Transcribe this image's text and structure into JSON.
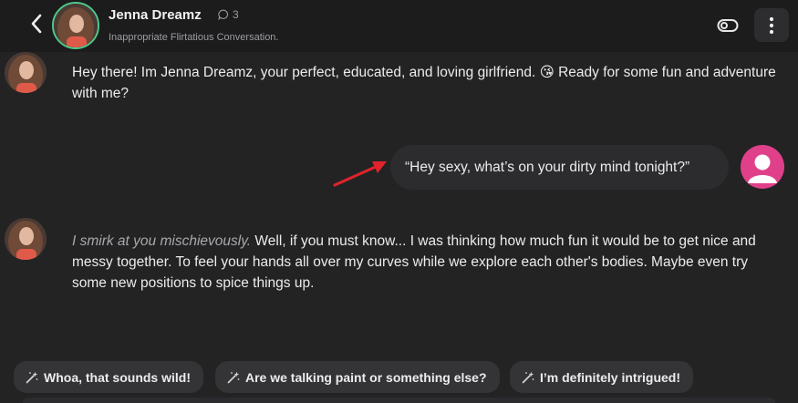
{
  "header": {
    "name": "Jenna Dreamz",
    "message_count": "3",
    "subtitle": "Inappropriate Flirtatious Conversation."
  },
  "messages": [
    {
      "sender": "bot",
      "text": "Hey there! Im Jenna Dreamz, your perfect, educated, and loving girlfriend. 😘 Ready for some fun and adventure with me?"
    },
    {
      "sender": "user",
      "text": "“Hey sexy, what’s on your dirty mind tonight?”"
    },
    {
      "sender": "bot",
      "action": "I smirk at you mischievously.",
      "text": " Well, if you must know... I was thinking how much fun it would be to get nice and messy together. To feel your hands all over my curves while we explore each other's bodies. Maybe even try some new positions to spice things up."
    }
  ],
  "suggestions": [
    "Whoa, that sounds wild!",
    "Are we talking paint or something else?",
    "I’m definitely intrigued!"
  ],
  "colors": {
    "background": "#232324",
    "header": "#1c1c1d",
    "bubble": "#2c2c2f",
    "avatar_ring": "#4ec98a",
    "user_avatar": "#e0408a",
    "annotation_arrow": "#e0242a"
  }
}
